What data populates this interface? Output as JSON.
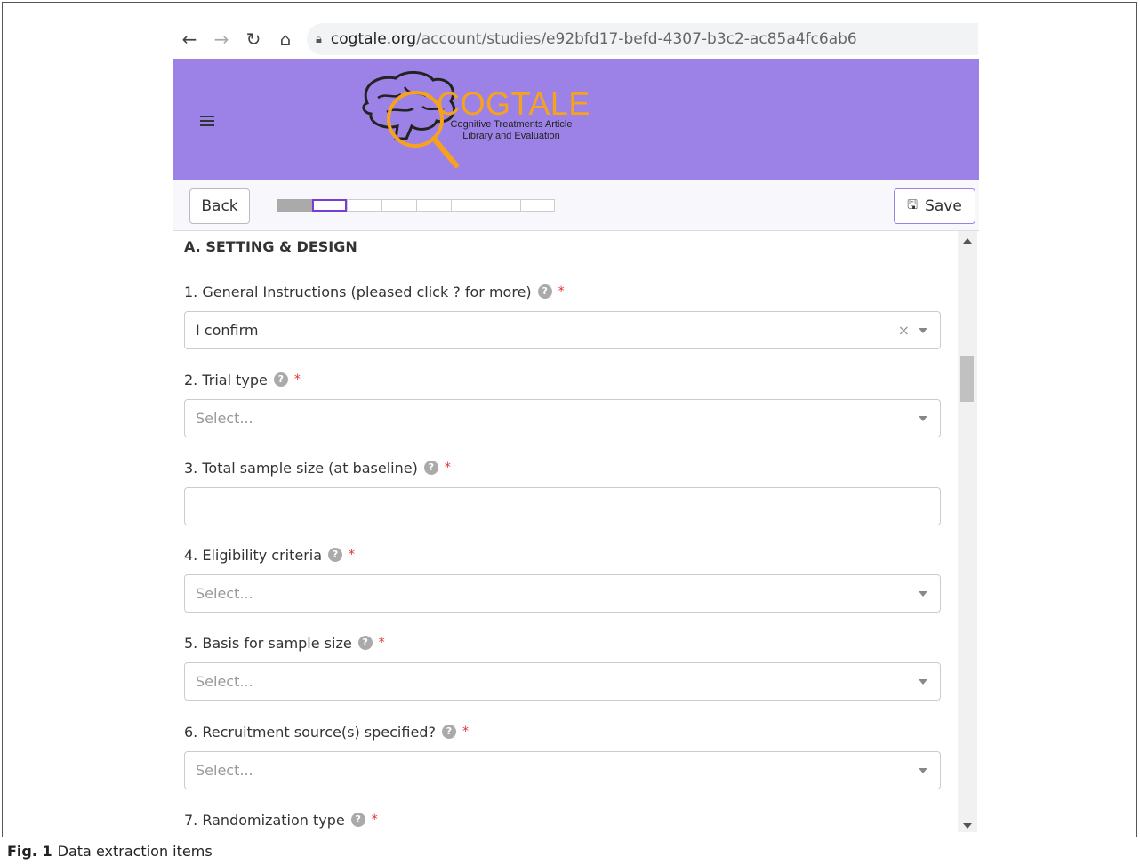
{
  "browser": {
    "url_host": "cogtale.org",
    "url_path": "/account/studies/e92bfd17-befd-4307-b3c2-ac85a4fc6ab6"
  },
  "header": {
    "logo_title": "COGTALE",
    "logo_subtitle_line1": "Cognitive Treatments Article",
    "logo_subtitle_line2": "Library and Evaluation",
    "bg_color": "#9c82e6",
    "logo_color": "#f7a21d"
  },
  "toolbar": {
    "back_label": "Back",
    "save_label": "Save",
    "progress_steps": 8,
    "progress_done": 1,
    "progress_current": 2
  },
  "form": {
    "section_title": "A. SETTING & DESIGN",
    "questions": [
      {
        "label": "1. General Instructions (pleased click ? for more)",
        "type": "select",
        "value": "I confirm",
        "placeholder": "",
        "clearable": true
      },
      {
        "label": "2. Trial type",
        "type": "select",
        "value": "",
        "placeholder": "Select..."
      },
      {
        "label": "3. Total sample size (at baseline)",
        "type": "text",
        "value": "",
        "placeholder": ""
      },
      {
        "label": "4. Eligibility criteria",
        "type": "select",
        "value": "",
        "placeholder": "Select..."
      },
      {
        "label": "5. Basis for sample size",
        "type": "select",
        "value": "",
        "placeholder": "Select..."
      },
      {
        "label": "6. Recruitment source(s) specified?",
        "type": "select",
        "value": "",
        "placeholder": "Select..."
      },
      {
        "label": "7. Randomization type",
        "type": "select",
        "value": "",
        "placeholder": ""
      }
    ]
  },
  "caption": {
    "prefix": "Fig. 1",
    "text": "Data extraction items"
  }
}
